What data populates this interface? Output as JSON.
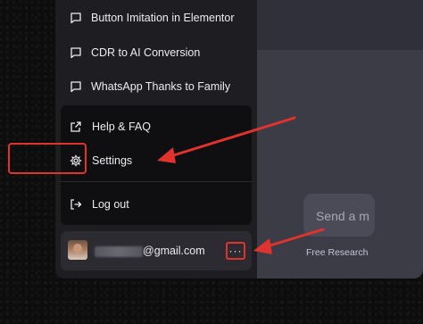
{
  "sidebar": {
    "chats": [
      {
        "label": "Button Imitation in Elementor",
        "icon": "chat-bubble-icon"
      },
      {
        "label": "CDR to AI Conversion",
        "icon": "chat-bubble-icon"
      },
      {
        "label": "WhatsApp Thanks to Family",
        "icon": "chat-bubble-icon"
      }
    ],
    "menu": {
      "help_label": "Help & FAQ",
      "settings_label": "Settings",
      "logout_label": "Log out"
    },
    "user": {
      "email_visible": "@gmail.com",
      "more_label": "···"
    }
  },
  "main": {
    "input_placeholder": "Send a m",
    "footer_note": "Free Research"
  },
  "annotations": {
    "highlight_color": "#e0332d"
  }
}
